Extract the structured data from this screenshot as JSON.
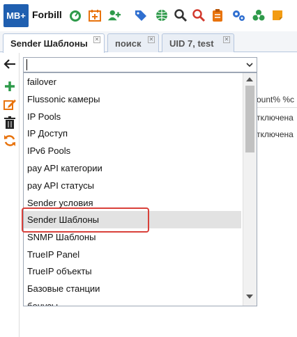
{
  "app": {
    "logo_text": "MB+",
    "brand_name": "Forbill",
    "toolbar_icons": [
      "dashboard-icon",
      "calendar-add-icon",
      "add-user-icon",
      "tags-icon",
      "globe-icon",
      "search-icon",
      "search-red-icon",
      "clipboard-icon",
      "settings-icon",
      "biohazard-icon",
      "note-icon"
    ]
  },
  "tabs": [
    {
      "label": "Sender Шаблоны",
      "active": true
    },
    {
      "label": "поиск",
      "active": false
    },
    {
      "label": "UID 7, test",
      "active": false
    }
  ],
  "side_tools": [
    "back-arrow-icon",
    "add-icon",
    "edit-icon",
    "delete-icon",
    "refresh-icon"
  ],
  "background_table": {
    "header_fragment": "ount% %c",
    "rows": [
      "тключена",
      "тключена"
    ]
  },
  "combo": {
    "value": ""
  },
  "dropdown": {
    "options": [
      "failover",
      "Flussonic камеры",
      "IP Pools",
      "IP Доступ",
      "IPv6 Pools",
      "pay API категории",
      "pay API статусы",
      "Sender условия",
      "Sender Шаблоны",
      "SNMP Шаблоны",
      "TrueIP Panel",
      "TrueIP объекты",
      "Базовые станции",
      "бонусы"
    ],
    "selected_option": "Sender Шаблоны"
  },
  "colors": {
    "highlight": "#d9403a",
    "logo_bg": "#1f5fb0",
    "selected_bg": "#e2e2e2"
  }
}
